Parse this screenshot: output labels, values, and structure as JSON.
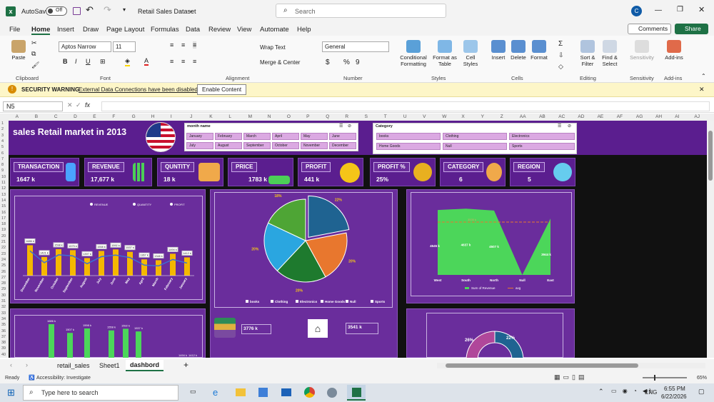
{
  "titlebar": {
    "autosave": "AutoSave",
    "toggle": "Off",
    "doc_title": "Retail Sales Dataset",
    "search_placeholder": "Search",
    "avatar": "C"
  },
  "ribbon_tabs": [
    "File",
    "Home",
    "Insert",
    "Draw",
    "Page Layout",
    "Formulas",
    "Data",
    "Review",
    "View",
    "Automate",
    "Help"
  ],
  "ribbon_actions": {
    "comments": "Comments",
    "share": "Share"
  },
  "ribbon": {
    "paste": "Paste",
    "clipboard": "Clipboard",
    "font_name": "Aptos Narrow",
    "font_size": "11",
    "font_group": "Font",
    "wrap_text": "Wrap Text",
    "merge_center": "Merge & Center",
    "alignment": "Alignment",
    "number_format": "General",
    "number": "Number",
    "conditional": "Conditional Formatting",
    "format_table": "Format as Table",
    "cell_styles": "Cell Styles",
    "styles": "Styles",
    "insert": "Insert",
    "delete": "Delete",
    "format": "Format",
    "cells": "Cells",
    "sort_filter": "Sort & Filter",
    "find_select": "Find & Select",
    "editing": "Editing",
    "sensitivity": "Sensitivity",
    "addins": "Add-ins"
  },
  "security": {
    "label": "SECURITY WARNING",
    "message": "External Data Connections have been disabled",
    "button": "Enable Content"
  },
  "formula_bar": {
    "name_box": "N5",
    "fx": "fx"
  },
  "columns": [
    "A",
    "B",
    "C",
    "D",
    "E",
    "F",
    "G",
    "H",
    "I",
    "J",
    "K",
    "L",
    "M",
    "N",
    "O",
    "P",
    "Q",
    "R",
    "S",
    "T",
    "U",
    "V",
    "W",
    "X",
    "Y",
    "Z",
    "AA",
    "AB",
    "AC",
    "AD",
    "AE",
    "AF",
    "AG",
    "AH",
    "AI",
    "AJ"
  ],
  "rows": [
    "1",
    "2",
    "3",
    "4",
    "5",
    "6",
    "7",
    "8",
    "9",
    "10",
    "11",
    "12",
    "13",
    "14",
    "15",
    "16",
    "17",
    "18",
    "19",
    "20",
    "21",
    "22",
    "23",
    "24",
    "25",
    "26",
    "27",
    "28",
    "29",
    "30",
    "31",
    "32",
    "33",
    "34",
    "35",
    "36",
    "37",
    "38",
    "39",
    "40"
  ],
  "dashboard": {
    "title": "sales Retail  market in 2013",
    "month_slicer": {
      "header": "month name",
      "items": [
        "January",
        "February",
        "March",
        "April",
        "May",
        "June",
        "July",
        "August",
        "September",
        "October",
        "November",
        "December"
      ]
    },
    "category_slicer": {
      "header": "Category",
      "items": [
        "books",
        "Clothing",
        "Electronics",
        "Home Goods",
        "Null",
        "Sports"
      ]
    },
    "kpis": [
      {
        "label": "TRANSACTION",
        "value": "1647 k",
        "color": "#4aa3ff"
      },
      {
        "label": "REVENUE",
        "value": "17,677 k",
        "color": "#4ccf57"
      },
      {
        "label": "QUNTITY",
        "value": "18 k",
        "color": "#f0a94a"
      },
      {
        "label": "PRICE",
        "value": "1783 k",
        "color": "#4ccf57"
      },
      {
        "label": "PROFIT",
        "value": "441 k",
        "color": "#f5c518"
      },
      {
        "label": "PROFIT %",
        "value": "25%",
        "color": "#e8b020"
      },
      {
        "label": "CATEGORY",
        "value": "6",
        "color": "#f0a94a"
      },
      {
        "label": "REGION",
        "value": "5",
        "color": "#66ccee"
      }
    ]
  },
  "chart_data": [
    {
      "type": "bar",
      "legend": [
        "REVENUE",
        "QUANTITY",
        "PROFIT"
      ],
      "categories": [
        "December",
        "November",
        "October",
        "September",
        "August",
        "July",
        "June",
        "May",
        "April",
        "March",
        "February",
        "January"
      ],
      "values": [
        1686,
        1421,
        1598,
        1575,
        1397,
        1558,
        1592,
        1537,
        1367,
        1348,
        1494,
        1412
      ],
      "data_labels": [
        "1686 k",
        "1421 k",
        "1598 k",
        "1575 k",
        "1397 k",
        "1558 k",
        "1592 k",
        "1537 k",
        "1367 k",
        "1348 k",
        "1494 k",
        "1412 k"
      ],
      "ylim": [
        0,
        2000
      ]
    },
    {
      "type": "pie",
      "categories": [
        "books",
        "Clothing",
        "Electronics",
        "Home Goods",
        "Null",
        "Sports"
      ],
      "values": [
        22,
        20,
        20,
        20,
        0,
        18
      ],
      "labels": [
        "22%",
        "20%",
        "20%",
        "20%",
        "18%"
      ],
      "colors": [
        "#1f6391",
        "#e8772e",
        "#1e7a2e",
        "#2aa6e0",
        "#6a2d9c",
        "#4ea535"
      ]
    },
    {
      "type": "area",
      "categories": [
        "West",
        "South",
        "North",
        "Null",
        "East"
      ],
      "values": [
        4545,
        4637,
        4507,
        0,
        3944
      ],
      "data_labels": [
        "4545 k",
        "4637 k",
        "4507 k",
        "3944 k"
      ],
      "avg": "3535 k",
      "legend": [
        "Sum of Revenue",
        "avg"
      ]
    },
    {
      "type": "bar",
      "values": [
        1686,
        1507,
        1598,
        1558,
        1592,
        1537
      ],
      "data_labels": [
        "1686 k",
        "1507 k",
        "1598 k",
        "1558 k",
        "1592 k",
        "1537 k",
        "1494 k",
        "1412 k"
      ]
    },
    {
      "type": "pie",
      "labels": [
        "26%",
        "22%"
      ]
    }
  ],
  "bottom_values": {
    "a": "3776 k",
    "b": "3541 k"
  },
  "sheet_tabs": [
    "retail_sales",
    "Sheet1",
    "dashbord"
  ],
  "status": {
    "ready": "Ready",
    "accessibility": "Accessibility: Investigate",
    "zoom": "65%"
  },
  "taskbar": {
    "search": "Type here to search",
    "lang": "ENG",
    "time": "6:55 PM",
    "date": "6/22/2026"
  }
}
